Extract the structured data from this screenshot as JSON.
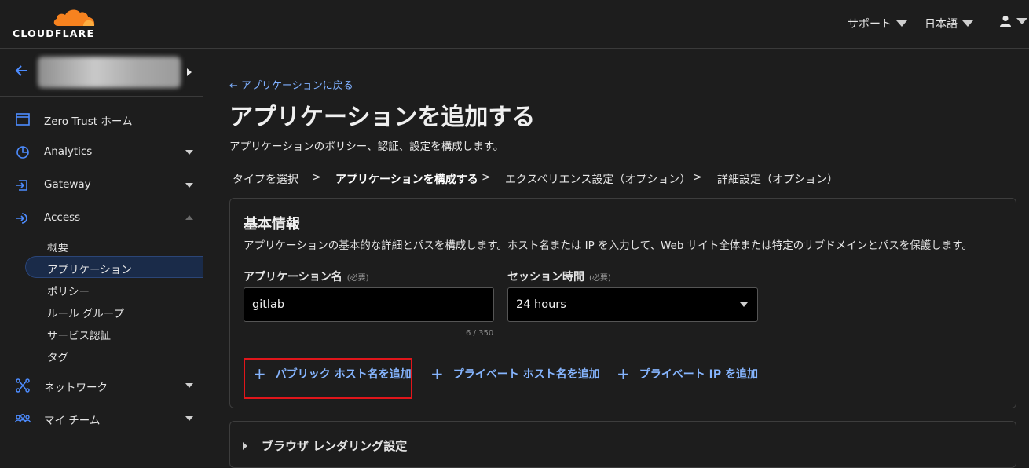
{
  "header": {
    "logo_text": "CLOUDFLARE",
    "support_label": "サポート",
    "language_label": "日本語",
    "brand_color": "#f6821f"
  },
  "sidebar": {
    "items": [
      {
        "label": "Zero Trust ホーム",
        "icon": "browser-window-icon"
      },
      {
        "label": "Analytics",
        "icon": "pie-chart-icon"
      },
      {
        "label": "Gateway",
        "icon": "gateway-icon"
      },
      {
        "label": "Access",
        "icon": "access-icon"
      },
      {
        "label": "ネットワーク",
        "icon": "network-icon"
      },
      {
        "label": "マイ チーム",
        "icon": "team-icon"
      }
    ],
    "access_sub": [
      "概要",
      "アプリケーション",
      "ポリシー",
      "ルール グループ",
      "サービス認証",
      "タグ"
    ],
    "active_sub": "アプリケーション"
  },
  "main": {
    "back_link": "← アプリケーションに戻る",
    "title": "アプリケーションを追加する",
    "description": "アプリケーションのポリシー、認証、設定を構成します。",
    "steps": [
      "タイプを選択",
      "アプリケーションを構成する",
      "エクスペリエンス設定（オプション）",
      "詳細設定（オプション）"
    ],
    "step_separator": ">",
    "active_step": "アプリケーションを構成する"
  },
  "basic_info": {
    "title": "基本情報",
    "description": "アプリケーションの基本的な詳細とパスを構成します。ホスト名または IP を入力して、Web サイト全体または特定のサブドメインとパスを保護します。",
    "app_name_label": "アプリケーション名",
    "app_name_required": "(必要)",
    "app_name_value": "gitlab",
    "app_name_counter": "6 / 350",
    "session_label": "セッション時間",
    "session_required": "(必要)",
    "session_value": "24 hours",
    "buttons": {
      "public_hostname": "パブリック ホスト名を追加",
      "private_hostname": "プライベート ホスト名を追加",
      "private_ip": "プライベート IP を追加"
    },
    "plus_glyph": "+"
  },
  "browser_rendering": {
    "title": "ブラウザ レンダリング設定"
  }
}
